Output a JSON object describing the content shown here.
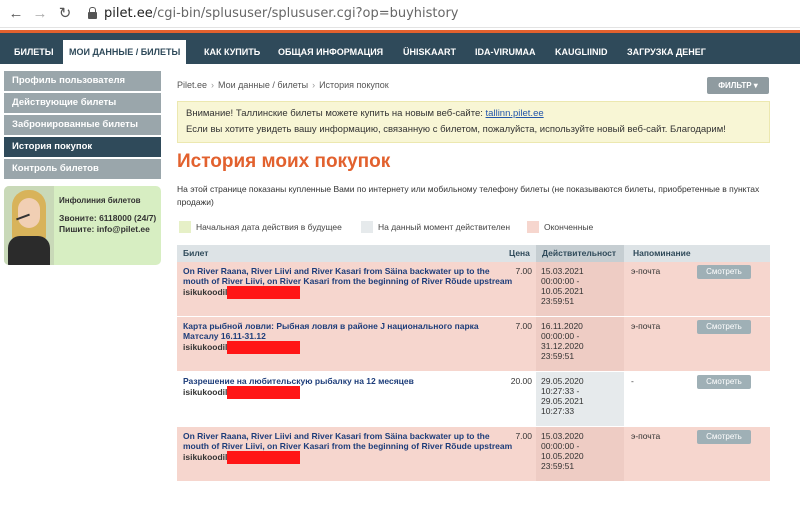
{
  "browser": {
    "url_host": "pilet.ee",
    "url_path": "/cgi-bin/splususer/splususer.cgi?op=buyhistory",
    "back_glyph": "←",
    "forward_glyph": "→",
    "reload_glyph": "↻"
  },
  "topnav": {
    "items": [
      {
        "label": "БИЛЕТЫ"
      },
      {
        "label": "МОИ ДАННЫЕ / БИЛЕТЫ",
        "active": true
      },
      {
        "label": "КАК КУПИТЬ"
      },
      {
        "label": "ОБЩАЯ ИНФОРМАЦИЯ"
      },
      {
        "label": "ÜHISKAART"
      },
      {
        "label": "IDA-VIRUMAA"
      },
      {
        "label": "KAUGLIINID"
      },
      {
        "label": "ЗАГРУЗКА ДЕНЕГ"
      }
    ]
  },
  "sidebar": {
    "items": [
      {
        "label": "Профиль пользователя"
      },
      {
        "label": "Действующие билеты"
      },
      {
        "label": "Забронированные билеты"
      },
      {
        "label": "История покупок",
        "active": true
      },
      {
        "label": "Контроль билетов"
      }
    ],
    "info": {
      "title": "Инфолиния билетов",
      "phone": "Звоните: 6118000 (24/7)",
      "email": "Пишите: info@pilet.ee"
    }
  },
  "breadcrumb": [
    "Pilet.ee",
    "Мои данные / билеты",
    "История покупок"
  ],
  "filter_label": "ФИЛЬТР",
  "filter_caret": "▾",
  "notice": {
    "line1_prefix": "Внимание! Таллинские билеты можете купить на новым веб-сайте: ",
    "line1_link": "tallinn.pilet.ee",
    "line2": "Если вы хотите увидеть вашу информацию, связанную с билетом, пожалуйста, используйте новый веб-сайт. Благодарим!"
  },
  "page_title": "История моих покупок",
  "intro": "На этой странице показаны купленные Вами по интернету или мобильному телефону билеты (не показываются билеты, приобретенные в пунктах продажи)",
  "legend": [
    {
      "label": "Начальная дата действия в будущее",
      "color": "#e6f0c7"
    },
    {
      "label": "На данный момент действителен",
      "color": "#e6eaec"
    },
    {
      "label": "Оконченные",
      "color": "#f6d6ce"
    }
  ],
  "table": {
    "headers": {
      "ticket": "Билет",
      "price": "Цена",
      "valid": "Действительност",
      "reminder": "Напоминание"
    },
    "rows": [
      {
        "status": "ended",
        "title": "On River Raana, River Liivi and River Kasari from Säina backwater up to the mouth of River Liivi, on River Kasari from the beginning of River Rõude upstream",
        "id_label": "isikukoodil",
        "price": "7.00",
        "valid_from_date": "15.03.2021",
        "valid_from_time": "00:00:00 -",
        "valid_to_date": "10.05.2021",
        "valid_to_time": "23:59:51",
        "reminder": "э-почта",
        "button": "Смотреть"
      },
      {
        "status": "ended",
        "title": "Карта рыбной ловли: Рыбная ловля в районе J национального парка Матсалу 16.11-31.12",
        "id_label": "isikukoodil",
        "price": "7.00",
        "valid_from_date": "16.11.2020",
        "valid_from_time": "00:00:00 -",
        "valid_to_date": "31.12.2020",
        "valid_to_time": "23:59:51",
        "reminder": "э-почта",
        "button": "Смотреть"
      },
      {
        "status": "current",
        "title": "Разрешение на любительскую рыбалку на 12 месяцев",
        "id_label": "isikukoodil",
        "price": "20.00",
        "valid_from_date": "29.05.2020",
        "valid_from_time": "10:27:33 -",
        "valid_to_date": "29.05.2021",
        "valid_to_time": "10:27:33",
        "reminder": "-",
        "button": "Смотреть"
      },
      {
        "status": "ended",
        "title": "On River Raana, River Liivi and River Kasari from Säina backwater up to the mouth of River Liivi, on River Kasari from the beginning of River Rõude upstream",
        "id_label": "isikukoodil",
        "price": "7.00",
        "valid_from_date": "15.03.2020",
        "valid_from_time": "00:00:00 -",
        "valid_to_date": "10.05.2020",
        "valid_to_time": "23:59:51",
        "reminder": "э-почта",
        "button": "Смотреть"
      }
    ]
  },
  "colors": {
    "accent": "#e2612e",
    "nav_dark": "#2f4a5a",
    "sidebar_gray": "#9aa6ab",
    "ended_row": "#f6d6ce",
    "redaction": "#ff1616"
  }
}
